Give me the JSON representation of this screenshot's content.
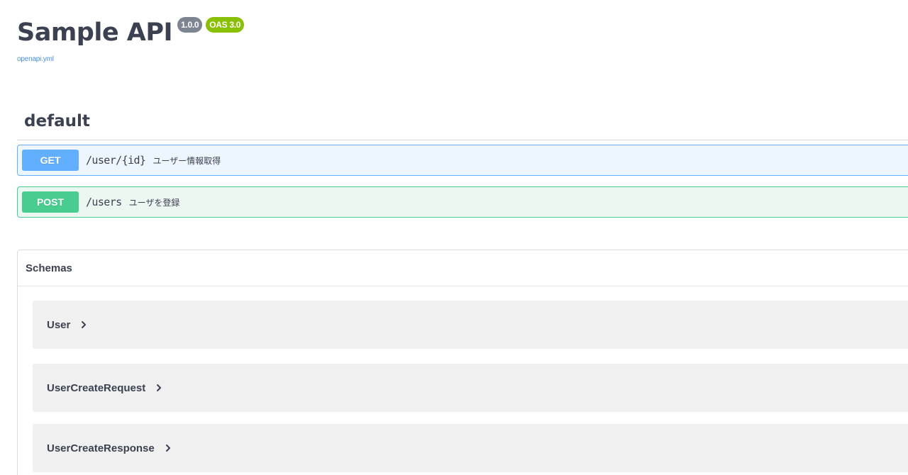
{
  "info": {
    "title": "Sample API",
    "version": "1.0.0",
    "oas": "OAS 3.0",
    "spec_link": "openapi.yml"
  },
  "tag": {
    "name": "default"
  },
  "operations": [
    {
      "method": "GET",
      "path": "/user/{id}",
      "summary": "ユーザー情報取得"
    },
    {
      "method": "POST",
      "path": "/users",
      "summary": "ユーザを登録"
    }
  ],
  "schemas": {
    "title": "Schemas",
    "items": [
      {
        "name": "User"
      },
      {
        "name": "UserCreateRequest"
      },
      {
        "name": "UserCreateResponse"
      }
    ]
  },
  "colors": {
    "get": "#61affe",
    "post": "#49cc90",
    "version_badge": "#7d8492",
    "oas_badge": "#89bf04",
    "link": "#4990e2"
  },
  "icons": {
    "expand": "chevron-right-icon"
  }
}
